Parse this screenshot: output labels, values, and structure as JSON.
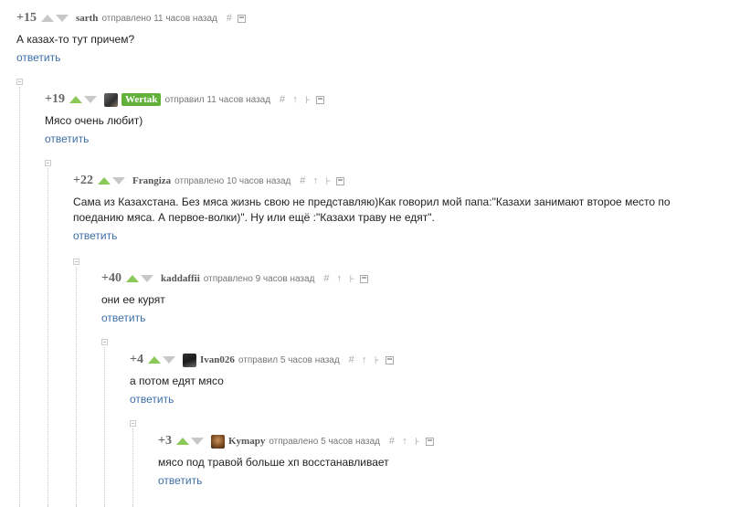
{
  "comments": [
    {
      "rating": "+15",
      "author": "sarth",
      "action": "отправлено 11 часов назад",
      "text": "А казах-то тут причем?",
      "reply": "ответить"
    },
    {
      "rating": "+19",
      "author": "Wertak",
      "action": "отправил 11 часов назад",
      "text": "Мясо очень любит)",
      "reply": "ответить"
    },
    {
      "rating": "+22",
      "author": "Frangiza",
      "action": "отправлено 10 часов назад",
      "text": "Сама из Казахстана. Без мяса жизнь свою не представляю)Как говорил мой папа:\"Казахи занимают второе место по поеданию мяса. А первое-волки)\". Ну или ещё :\"Казахи траву не едят\".",
      "reply": "ответить"
    },
    {
      "rating": "+40",
      "author": "kaddaffii",
      "action": "отправлено 9 часов назад",
      "text": "они ее курят",
      "reply": "ответить"
    },
    {
      "rating": "+4",
      "author": "Ivan026",
      "action": "отправил 5 часов назад",
      "text": "а потом едят мясо",
      "reply": "ответить"
    },
    {
      "rating": "+3",
      "author": "Kymapy",
      "action": "отправлено 5 часов назад",
      "text": "мясо под травой больше хп восстанавливает",
      "reply": "ответить"
    }
  ],
  "icons": {
    "link": "#",
    "up_parent": "↑",
    "branch": "⊦"
  },
  "colors": {
    "vote_up_active": "#8ac858",
    "author_badge": "#62b13b",
    "reply_link": "#3d6fa8"
  }
}
